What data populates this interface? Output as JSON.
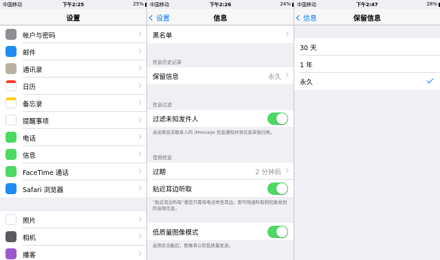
{
  "status_bars": [
    {
      "carrier": "中国移动",
      "time": "下午2:25",
      "battery": "25%",
      "battery_level": 0.25
    },
    {
      "carrier": "中国移动",
      "time": "下午2:26",
      "battery": "24%",
      "battery_level": 0.24
    },
    {
      "carrier": "中国移动",
      "time": "下午2:47",
      "battery": "28%",
      "battery_level": 0.28
    }
  ],
  "settings": {
    "title": "设置",
    "group1": [
      {
        "label": "帐户与密码",
        "icon": "key-icon",
        "color": "#8e8e93"
      },
      {
        "label": "邮件",
        "icon": "mail-icon",
        "color": "#1e8cf0"
      },
      {
        "label": "通讯录",
        "icon": "contacts-icon",
        "color": "#b9b1a3"
      },
      {
        "label": "日历",
        "icon": "calendar-icon",
        "color": "#ff3b30"
      },
      {
        "label": "备忘录",
        "icon": "notes-icon",
        "color": "#ffcc00"
      },
      {
        "label": "提醒事项",
        "icon": "reminders-icon",
        "color": "#ff9500"
      },
      {
        "label": "电话",
        "icon": "phone-icon",
        "color": "#4cd964"
      },
      {
        "label": "信息",
        "icon": "messages-icon",
        "color": "#4cd964"
      },
      {
        "label": "FaceTime 通话",
        "icon": "facetime-icon",
        "color": "#4cd964"
      },
      {
        "label": "Safari 浏览器",
        "icon": "safari-icon",
        "color": "#1e8cf0"
      }
    ],
    "group2": [
      {
        "label": "照片",
        "icon": "photos-icon",
        "color": "#ff9500"
      },
      {
        "label": "相机",
        "icon": "camera-icon",
        "color": "#5a5a5f"
      },
      {
        "label": "播客",
        "icon": "podcasts-icon",
        "color": "#9b59d0"
      }
    ]
  },
  "messages": {
    "back": "设置",
    "title": "信息",
    "blocked": "黑名单",
    "history_header": "信息历史记录",
    "keep_messages": "保留信息",
    "keep_messages_value": "永久",
    "filter_header": "信息过滤",
    "filter_unknown": "过滤未知发件人",
    "filter_footer": "关闭来自非联系人的 iMessage 信息通知并将信息单独归类。",
    "audio_header": "音频信息",
    "expire": "过期",
    "expire_value": "2 分钟后",
    "raise_to_listen": "贴近耳边听取",
    "raise_footer": "“贴近耳边听取”使您只需将电话举至耳边，即可快速听取和回复收到的音频信息。",
    "low_quality": "低质量图像模式",
    "low_quality_footer": "启用此功能后，图像将以较低质量发送。"
  },
  "keep": {
    "back": "信息",
    "title": "保留信息",
    "options": [
      "30 天",
      "1 年",
      "永久"
    ],
    "selected": "永久"
  },
  "colors": {
    "accent": "#007aff",
    "toggle_on": "#4cd964"
  }
}
